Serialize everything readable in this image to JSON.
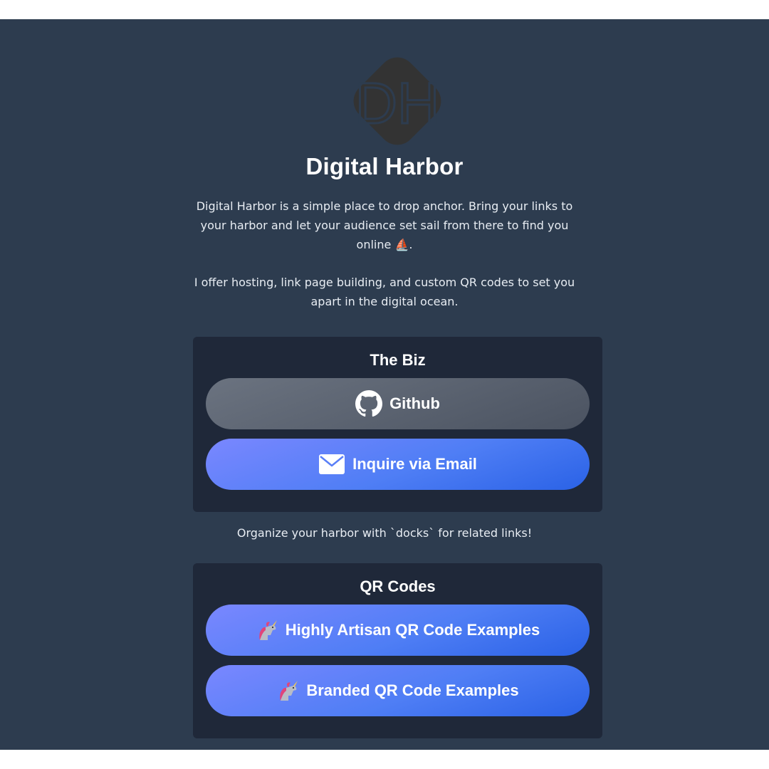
{
  "logo": {
    "text": "DH",
    "color": "#333333"
  },
  "title": "Digital Harbor",
  "description": {
    "line1": "Digital Harbor is a simple place to drop anchor. Bring your links to",
    "line2": "your harbor and let your audience set sail from there to find you",
    "line3": "online ⛵.",
    "line4": "I offer hosting, link page building, and custom QR codes to set you",
    "line5": "apart in the digital ocean."
  },
  "docks": [
    {
      "title": "The Biz",
      "links": [
        {
          "label": "Github",
          "icon": "github-icon"
        },
        {
          "label": "Inquire via Email",
          "icon": "mail-icon"
        }
      ]
    },
    {
      "title": "QR Codes",
      "links": [
        {
          "label": "Highly Artisan QR Code Examples",
          "icon": "unicorn-icon"
        },
        {
          "label": "Branded QR Code Examples",
          "icon": "unicorn-icon"
        }
      ]
    }
  ],
  "note": "Organize your harbor with `docks` for related links!",
  "colors": {
    "background": "#2d3c4f",
    "dock": "#1f2839",
    "button_blue": "#4f7ef5",
    "button_gray": "#5b6370"
  }
}
